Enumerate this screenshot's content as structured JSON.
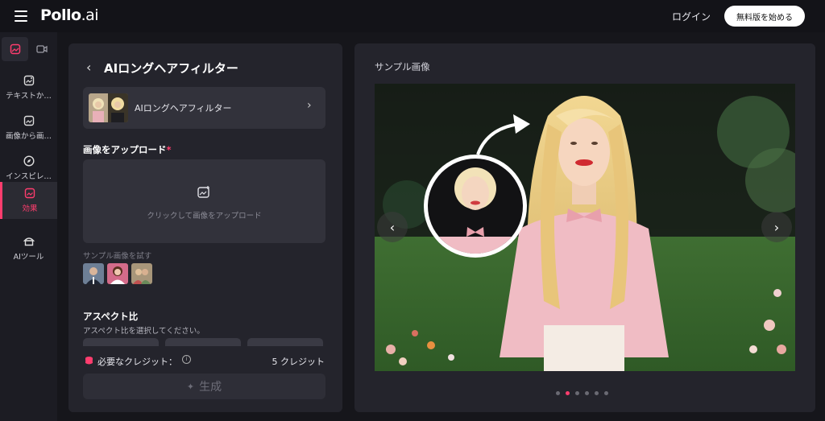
{
  "header": {
    "logo_main": "Pollo",
    "logo_domain": ".ai",
    "login_label": "ログイン",
    "trial_label": "無料版を始める"
  },
  "sidebar": {
    "items": [
      {
        "label": "テキストか…",
        "icon": "text-to-image-icon"
      },
      {
        "label": "画像から画…",
        "icon": "image-to-image-icon"
      },
      {
        "label": "インスピレ…",
        "icon": "compass-icon"
      },
      {
        "label": "効果",
        "icon": "effects-icon"
      },
      {
        "label": "AIツール",
        "icon": "ai-tools-icon"
      }
    ]
  },
  "panel": {
    "title": "AIロングヘアフィルター",
    "filter_name": "AIロングヘアフィルター",
    "upload_label": "画像をアップロード",
    "upload_required": "*",
    "upload_hint": "クリックして画像をアップロード",
    "sample_label": "サンプル画像を試す",
    "aspect_label": "アスペクト比",
    "aspect_sub": "アスペクト比を選択してください。",
    "credits_label": "必要なクレジット：",
    "credits_info": "i",
    "credits_value": "5 クレジット",
    "generate_label": "生成"
  },
  "preview": {
    "title": "サンプル画像",
    "prev_icon": "‹",
    "next_icon": "›",
    "dots_count": 6,
    "active_dot": 1
  },
  "colors": {
    "accent": "#ff3d6e",
    "bg": "#16161b",
    "panel": "#24242c"
  }
}
